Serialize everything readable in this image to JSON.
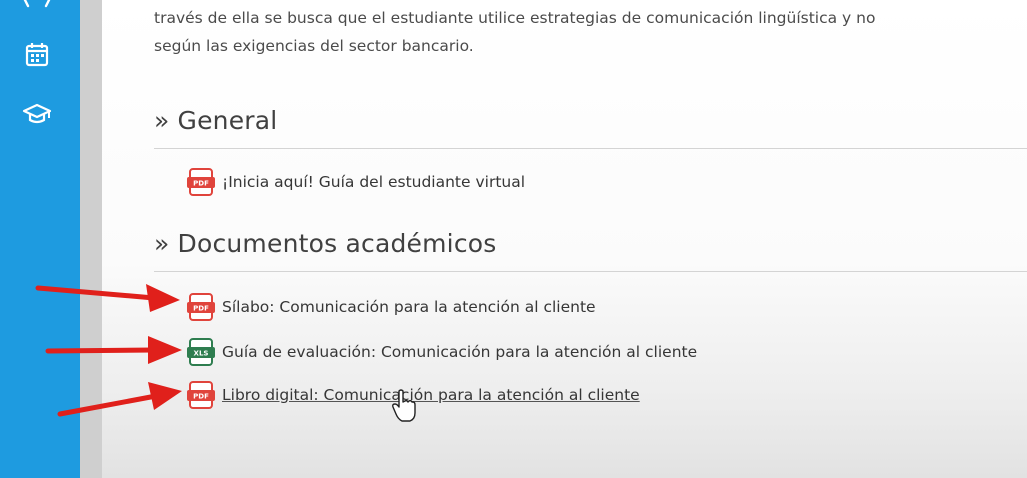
{
  "sidebar": {
    "items": [
      {
        "icon": "calendar-icon"
      },
      {
        "icon": "graduation-cap-icon"
      }
    ],
    "color": "#1e9be0"
  },
  "intro": {
    "line1": "través de ella se busca que el estudiante utilice estrategias de comunicación lingüística y no",
    "line2": "según las exigencias del sector bancario."
  },
  "sections": [
    {
      "title": "General",
      "marker": "»",
      "resources": [
        {
          "type": "PDF",
          "icon": "pdf-file-icon",
          "label": "¡Inicia aquí! Guía del estudiante virtual"
        }
      ]
    },
    {
      "title": "Documentos académicos",
      "marker": "»",
      "resources": [
        {
          "type": "PDF",
          "icon": "pdf-file-icon",
          "label": "Sílabo: Comunicación para la atención al cliente"
        },
        {
          "type": "XLS",
          "icon": "xls-file-icon",
          "label": "Guía de evaluación: Comunicación para la atención al cliente"
        },
        {
          "type": "PDF",
          "icon": "pdf-file-icon",
          "label": "Libro digital: Comunicación para la atención al cliente"
        }
      ]
    }
  ],
  "colors": {
    "pdf": "#e0443c",
    "xls": "#2e7d4f",
    "annotation_arrow": "#e0201b"
  }
}
